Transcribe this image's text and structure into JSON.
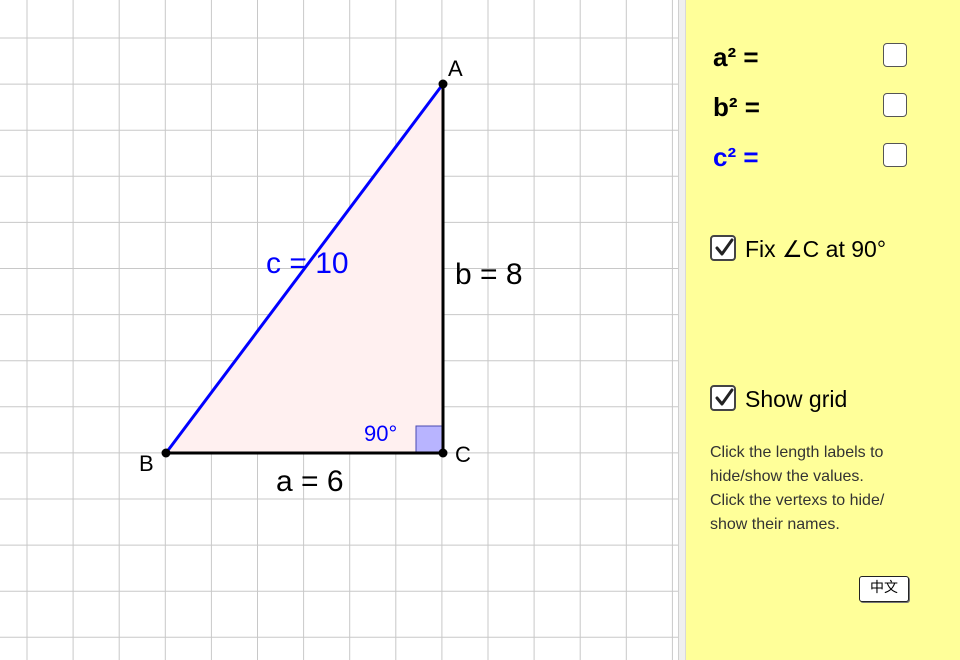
{
  "graphics": {
    "vertices": {
      "A": "A",
      "B": "B",
      "C": "C"
    },
    "side_labels": {
      "c": "c = 10",
      "b": "b = 8",
      "a": "a = 6"
    },
    "angle_label": "90°",
    "colors": {
      "hypotenuse": "#0000ff",
      "legs": "#000000",
      "fill": "#fff0f0",
      "right_angle_marker": "#b8b4ff",
      "grid": "#c8c8c8"
    }
  },
  "panel": {
    "background": "#ffff99",
    "squares": [
      {
        "label": "a² =",
        "checked": false
      },
      {
        "label": "b² =",
        "checked": false
      },
      {
        "label": "c² =",
        "checked": false
      }
    ],
    "options": {
      "fix_angle": {
        "label": "Fix ∠C at 90°",
        "checked": true
      },
      "show_grid": {
        "label": "Show grid",
        "checked": true
      }
    },
    "help_lines": [
      "Click the length labels to",
      "hide/show the values.",
      "Click the vertexs to hide/",
      "show their names."
    ],
    "language_button": "中文"
  }
}
